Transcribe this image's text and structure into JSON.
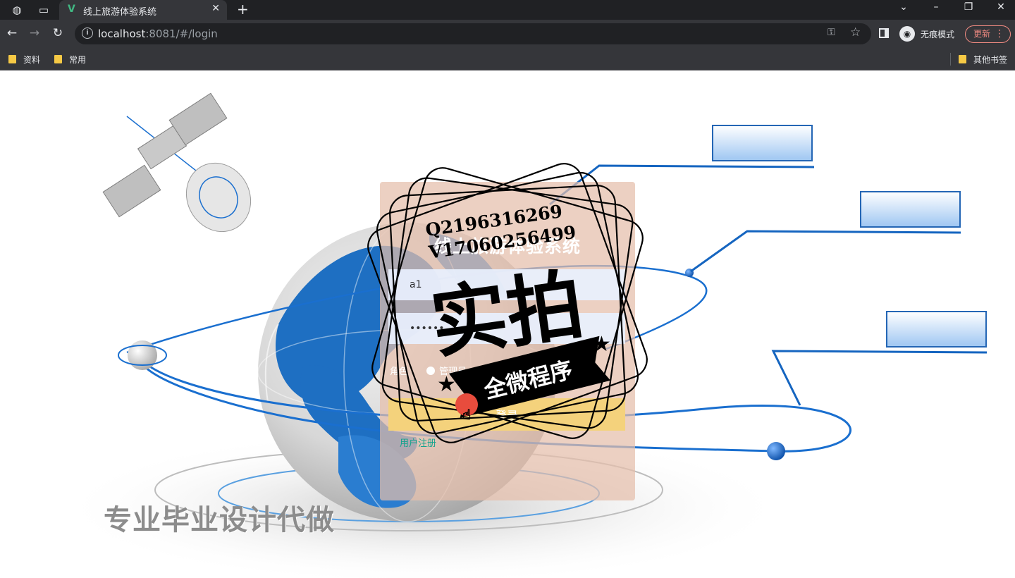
{
  "browser": {
    "tab_title": "线上旅游体验系统",
    "tab_favicon": "V",
    "url_host": "localhost",
    "url_rest": ":8081/#/login",
    "incognito_label": "无痕模式",
    "update_label": "更新",
    "bookmarks": [
      "资料",
      "常用"
    ],
    "other_bookmarks": "其他书签"
  },
  "login": {
    "title": "线上旅游体验系统",
    "username_value": "a1",
    "password_value": "••••••",
    "role_label": "角色",
    "role_option": "管理员",
    "login_label": "登录",
    "register_label": "用户注册"
  },
  "overlay": {
    "contact_q": "Q2196316269",
    "contact_v": "V17060256499",
    "stamp_main": "实拍",
    "stamp_sub": "全微程序",
    "slogan": "专业毕业设计代做"
  },
  "colors": {
    "chrome_dark": "#202124",
    "chrome_toolbar": "#35363a",
    "card_bg": "#e4beaa",
    "login_button": "#f4d27c",
    "register_link": "#13a38d",
    "globe_blue": "#1e6fc2"
  }
}
